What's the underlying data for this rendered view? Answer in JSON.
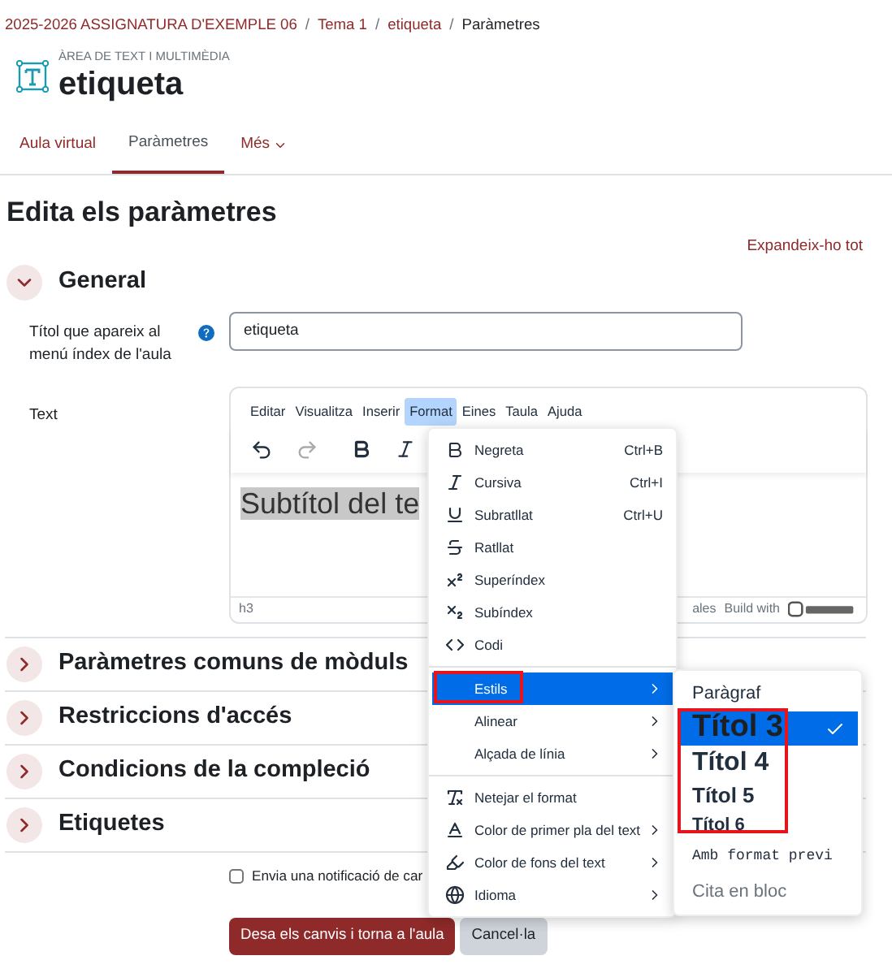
{
  "breadcrumb": [
    {
      "label": "2025-2026 ASSIGNATURA D'EXEMPLE 06",
      "link": true
    },
    {
      "label": "Tema 1",
      "link": true,
      "separator": "/"
    },
    {
      "label": "etiqueta",
      "link": true,
      "separator": "/"
    },
    {
      "label": "Paràmetres",
      "link": false,
      "separator": "/"
    }
  ],
  "header": {
    "category": "ÀREA DE TEXT I MULTIMÈDIA",
    "title": "etiqueta"
  },
  "nav_tabs": [
    {
      "label": "Aula virtual",
      "selected": false,
      "kind": "link"
    },
    {
      "label": "Paràmetres",
      "selected": true,
      "kind": "link"
    },
    {
      "label": "Més",
      "selected": false,
      "kind": "dropdown"
    }
  ],
  "page_title": "Edita els paràmetres",
  "expand_all": "Expandeix-ho tot",
  "general": {
    "title": "General",
    "expanded": true,
    "name_field": {
      "label": "Títol que apareix al menú índex de l'aula",
      "value": "etiqueta"
    },
    "text_field": {
      "label": "Text",
      "menubar": [
        {
          "label": "Editar",
          "selected": false
        },
        {
          "label": "Visualitza",
          "selected": false
        },
        {
          "label": "Inserir",
          "selected": false
        },
        {
          "label": "Format",
          "selected": true
        },
        {
          "label": "Eines",
          "selected": false
        },
        {
          "label": "Taula",
          "selected": false
        },
        {
          "label": "Ajuda",
          "selected": false
        }
      ],
      "content": "Subtítol del te",
      "status_path": "h3",
      "status_count": "ales",
      "branding": "Build with"
    }
  },
  "sections": [
    {
      "title": "Paràmetres comuns de mòduls",
      "expanded": false
    },
    {
      "title": "Restriccions d'accés",
      "expanded": false
    },
    {
      "title": "Condicions de la compleció",
      "expanded": false
    },
    {
      "title": "Etiquetes",
      "expanded": false
    }
  ],
  "notify": {
    "label": "Envia una notificació de car",
    "checked": false
  },
  "buttons": [
    {
      "label": "Desa els canvis i torna a l'aula",
      "kind": "primary"
    },
    {
      "label": "Cancel·la",
      "kind": "secondary"
    }
  ],
  "format_menu": [
    [
      {
        "label": "Negreta",
        "shortcut": "Ctrl+B"
      },
      {
        "label": "Cursiva",
        "shortcut": "Ctrl+I"
      },
      {
        "label": "Subratllat",
        "shortcut": "Ctrl+U"
      },
      {
        "label": "Ratllat"
      },
      {
        "label": "Superíndex"
      },
      {
        "label": "Subíndex"
      },
      {
        "label": "Codi"
      }
    ],
    [
      {
        "label": "Estils",
        "submenu": true,
        "selected": true
      },
      {
        "label": "Alinear",
        "submenu": true,
        "selected": false
      },
      {
        "label": "Alçada de línia",
        "submenu": true,
        "selected": false
      }
    ],
    [
      {
        "label": "Netejar el format"
      },
      {
        "label": "Color de primer pla del text",
        "submenu": true
      },
      {
        "label": "Color de fons del text",
        "submenu": true
      },
      {
        "label": "Idioma",
        "submenu": true
      }
    ]
  ],
  "styles_menu": [
    {
      "label": "Paràgraf",
      "kind": "paragraph",
      "selected": false
    },
    {
      "label": "Títol 3",
      "kind": "h3",
      "selected": true
    },
    {
      "label": "Títol 4",
      "kind": "h4",
      "selected": false
    },
    {
      "label": "Títol 5",
      "kind": "h5",
      "selected": false
    },
    {
      "label": "Títol 6",
      "kind": "h6",
      "selected": false
    },
    {
      "label": "Amb format previ",
      "kind": "pre",
      "selected": false
    },
    {
      "label": "Cita en bloc",
      "kind": "blockquote",
      "selected": false
    }
  ]
}
